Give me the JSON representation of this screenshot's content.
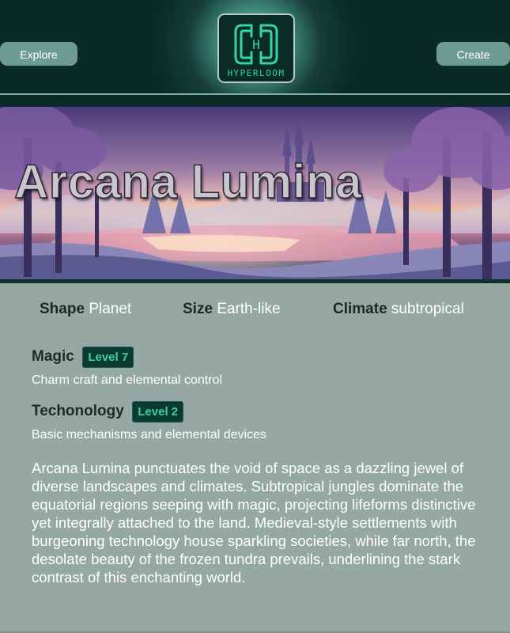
{
  "nav": {
    "explore_label": "Explore",
    "create_label": "Create"
  },
  "logo": {
    "text": "HYPERLOOM",
    "glyph": "H"
  },
  "banner": {
    "title": "Arcana Lumina"
  },
  "stats": [
    {
      "label": "Shape",
      "value": "Planet"
    },
    {
      "label": "Size",
      "value": "Earth-like"
    },
    {
      "label": "Climate",
      "value": "subtropical"
    }
  ],
  "magic": {
    "title": "Magic",
    "level": "Level 7",
    "description": "Charm craft and elemental control"
  },
  "technology": {
    "title": "Techonology",
    "level": "Level 2",
    "description": "Basic mechanisms and elemental devices"
  },
  "description": "Arcana Lumina punctuates the void of space as a dazzling jewel of diverse landscapes and climates. Subtropical jungles dominate the equatorial regions seeping with magic, projecting lifeforms distinctive yet integrally attached to the land. Medieval-style settlements with burgeoning technology house sparkling societies, while far north, the desolate beauty of the frozen tundra prevails, underlining the stark contrast of this enchanting world.",
  "colors": {
    "accent": "#36d3a4",
    "header_bg": "#0a2a25",
    "content_bg": "#96a8a3",
    "button_bg": "#6f9c90"
  }
}
